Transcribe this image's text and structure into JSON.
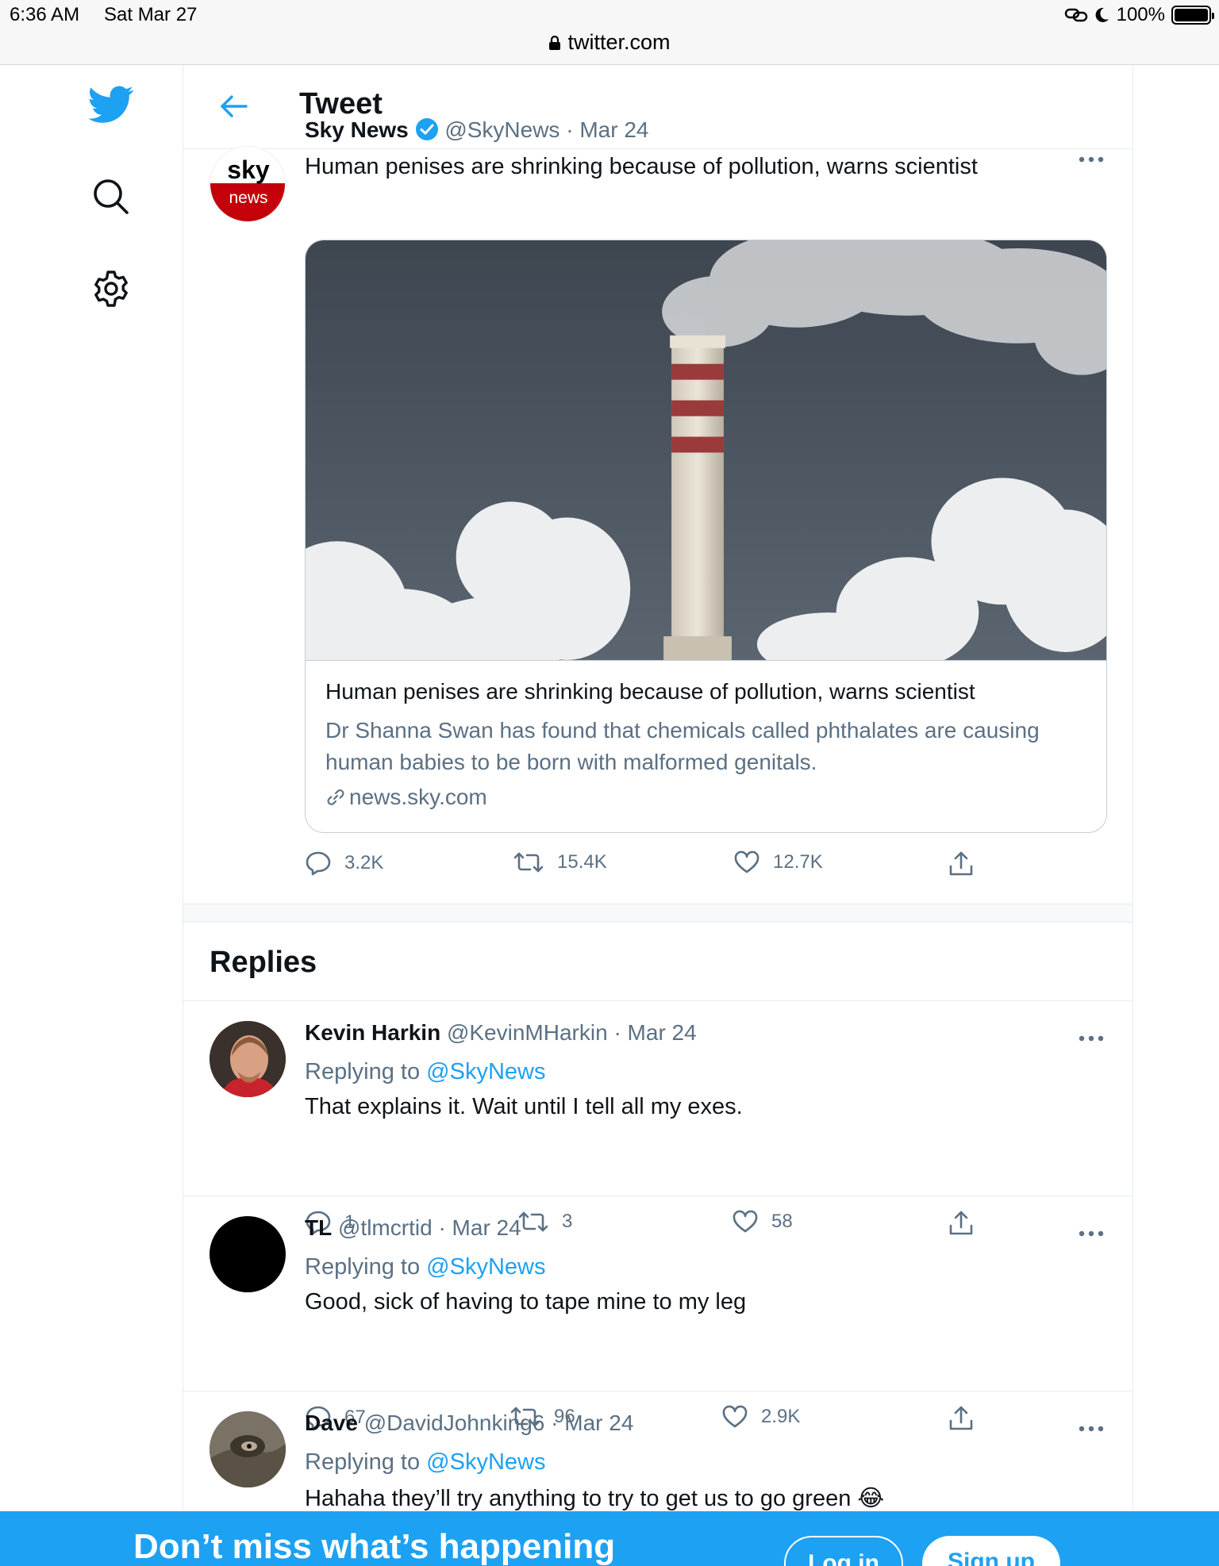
{
  "status_bar": {
    "time": "6:36 AM",
    "date": "Sat Mar 27",
    "battery": "100%"
  },
  "browser": {
    "url": "twitter.com"
  },
  "header": {
    "title": "Tweet"
  },
  "colors": {
    "accent": "#1da1f2",
    "muted": "#5b7083",
    "sky_red": "#c4000a"
  },
  "tweet": {
    "author": "Sky News",
    "handle": "@SkyNews",
    "date": "· Mar 24",
    "verified": true,
    "avatar_logo": {
      "top": "sky",
      "bottom": "news"
    },
    "text": "Human penises are shrinking because of pollution, warns scientist",
    "card": {
      "title": "Human penises are shrinking because of pollution, warns scientist",
      "description": "Dr Shanna Swan has found that chemicals called phthalates are causing human babies to be born with malformed genitals.",
      "domain": "news.sky.com"
    },
    "stats": {
      "replies": "3.2K",
      "retweets": "15.4K",
      "likes": "12.7K"
    }
  },
  "replies_section": {
    "title": "Replies"
  },
  "replies": [
    {
      "author": "Kevin Harkin",
      "handle": "@KevinMHarkin",
      "date": "· Mar 24",
      "replying_prefix": "Replying to",
      "replying_to": "@SkyNews",
      "text": "That explains it. Wait until I tell all my exes.",
      "stats": {
        "replies": "1",
        "retweets": "3",
        "likes": "58"
      }
    },
    {
      "author": "TL",
      "handle": "@tlmcrtid",
      "date": "· Mar 24",
      "replying_prefix": "Replying to",
      "replying_to": "@SkyNews",
      "text": "Good, sick of having to tape mine to my leg",
      "stats": {
        "replies": "67",
        "retweets": "96",
        "likes": "2.9K"
      }
    },
    {
      "author": "Dave",
      "handle": "@DavidJohnking6",
      "date": "· Mar 24",
      "replying_prefix": "Replying to",
      "replying_to": "@SkyNews",
      "text": "Hahaha they’ll try anything to try to get us to go green 😂"
    }
  ],
  "banner": {
    "text": "Don’t miss what’s happening",
    "login": "Log in",
    "signup": "Sign up"
  },
  "icons": [
    "twitter-bird-icon",
    "search-icon",
    "gear-icon",
    "back-arrow-icon",
    "more-icon",
    "reply-icon",
    "retweet-icon",
    "like-icon",
    "share-icon",
    "link-icon",
    "verified-badge-icon",
    "lock-icon"
  ]
}
